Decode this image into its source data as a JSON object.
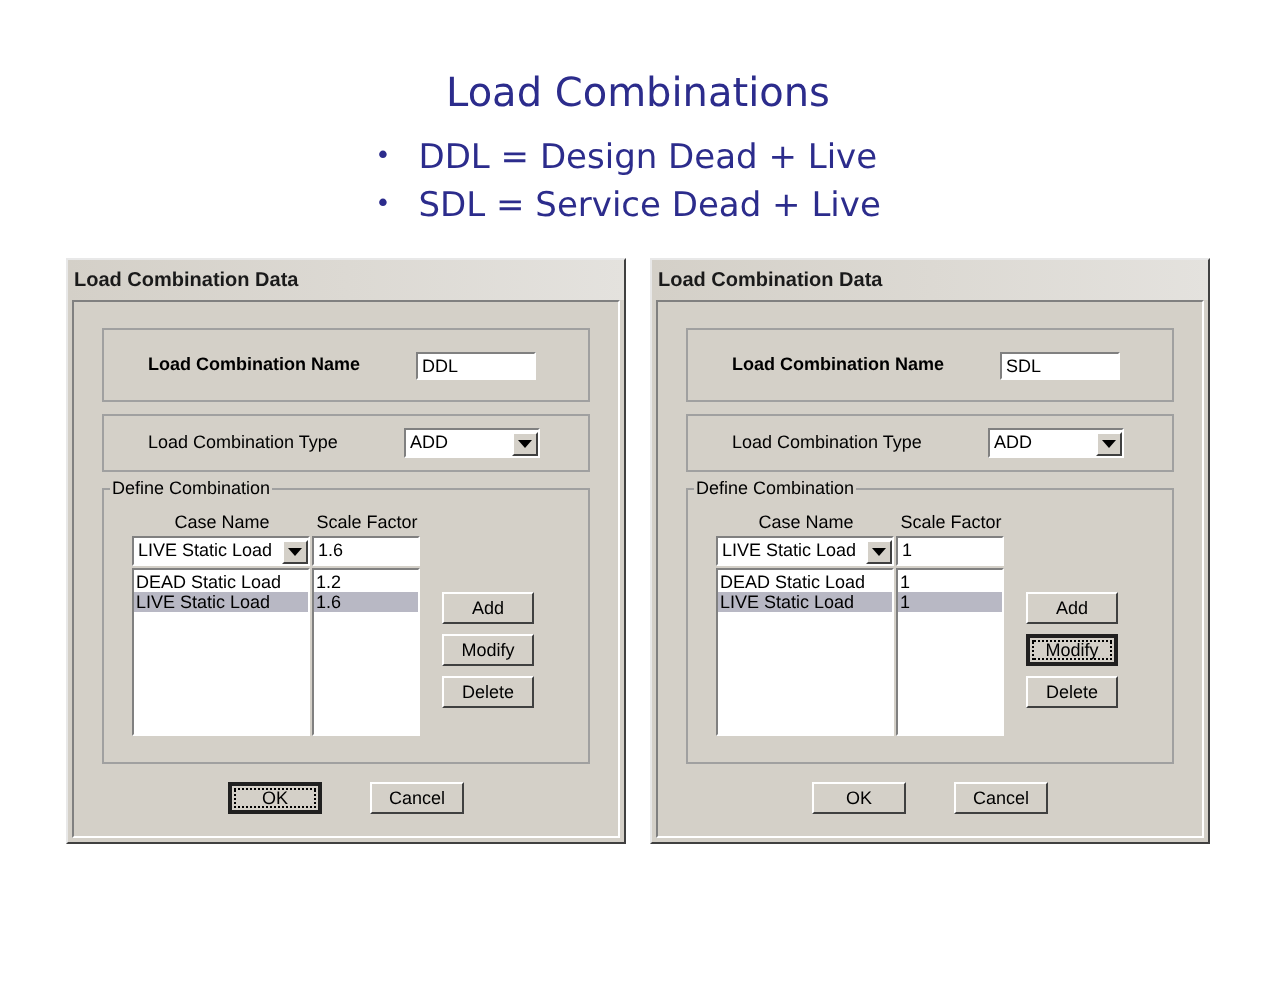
{
  "slide": {
    "title": "Load Combinations",
    "bullets": [
      {
        "marker": "•",
        "text": "DDL = Design Dead + Live"
      },
      {
        "marker": "•",
        "text": "SDL = Service Dead + Live"
      }
    ]
  },
  "dialogs": [
    {
      "title": "Load Combination Data",
      "name_label": "Load Combination Name",
      "name_value": "DDL",
      "type_label": "Load Combination Type",
      "type_value": "ADD",
      "group_label": "Define Combination",
      "case_header": "Case Name",
      "factor_header": "Scale Factor",
      "case_value": "LIVE Static Load",
      "factor_value": "1.6",
      "rows": [
        {
          "case": "DEAD Static Load",
          "factor": "1.2",
          "selected": false
        },
        {
          "case": "LIVE Static Load",
          "factor": "1.6",
          "selected": true
        }
      ],
      "side_buttons": [
        {
          "label": "Add",
          "focused": false
        },
        {
          "label": "Modify",
          "focused": false
        },
        {
          "label": "Delete",
          "focused": false
        }
      ],
      "footer_buttons": [
        {
          "label": "OK",
          "focused": true
        },
        {
          "label": "Cancel",
          "focused": false
        }
      ]
    },
    {
      "title": "Load Combination Data",
      "name_label": "Load Combination Name",
      "name_value": "SDL",
      "type_label": "Load Combination Type",
      "type_value": "ADD",
      "group_label": "Define Combination",
      "case_header": "Case Name",
      "factor_header": "Scale Factor",
      "case_value": "LIVE Static Load",
      "factor_value": "1",
      "rows": [
        {
          "case": "DEAD Static Load",
          "factor": "1",
          "selected": false
        },
        {
          "case": "LIVE Static Load",
          "factor": "1",
          "selected": true
        }
      ],
      "side_buttons": [
        {
          "label": "Add",
          "focused": false
        },
        {
          "label": "Modify",
          "focused": true
        },
        {
          "label": "Delete",
          "focused": false
        }
      ],
      "footer_buttons": [
        {
          "label": "OK",
          "focused": false
        },
        {
          "label": "Cancel",
          "focused": false
        }
      ]
    }
  ]
}
